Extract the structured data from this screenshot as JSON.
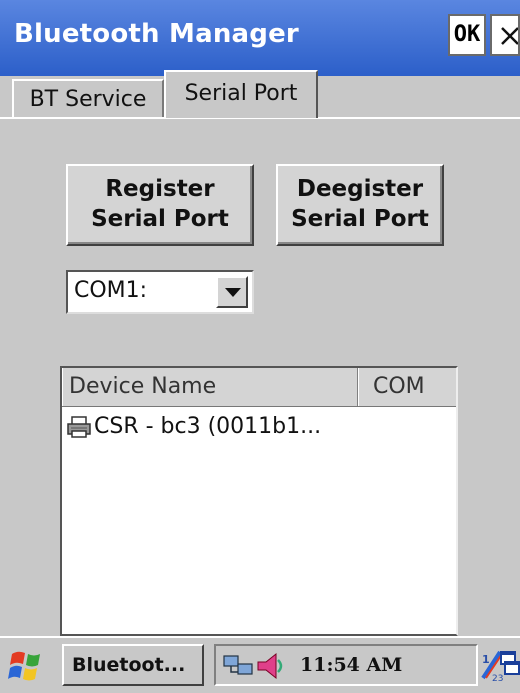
{
  "window": {
    "title": "Bluetooth Manager",
    "ok_label": "OK"
  },
  "tabs": [
    {
      "label": "BT Service",
      "active": false
    },
    {
      "label": "Serial Port",
      "active": true
    }
  ],
  "buttons": {
    "register": {
      "line1": "Register",
      "line2": "Serial Port"
    },
    "deregister": {
      "line1": "Deegister",
      "line2": "Serial Port"
    }
  },
  "com_select": {
    "value": "COM1:"
  },
  "device_list": {
    "columns": [
      "Device Name",
      "COM"
    ],
    "rows": [
      {
        "name": "CSR - bc3 (0011b1...",
        "com": "",
        "icon": "printer-icon"
      }
    ]
  },
  "taskbar": {
    "task_label": "Bluetoot...",
    "clock": "11:54 AM",
    "tray_icons": [
      "network-icon",
      "speaker-icon",
      "input-method-icon",
      "window-switch-icon"
    ]
  },
  "colors": {
    "titlebar": "#2c5fc9",
    "face": "#c8c8c8",
    "list_bg": "#ffffff"
  }
}
